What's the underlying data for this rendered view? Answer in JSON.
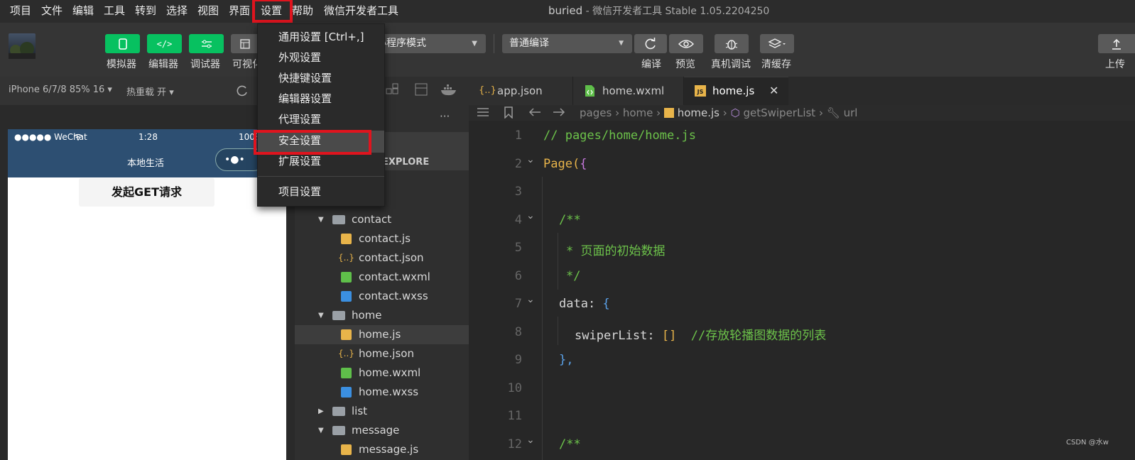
{
  "menubar": {
    "items": [
      "项目",
      "文件",
      "编辑",
      "工具",
      "转到",
      "选择",
      "视图",
      "界面",
      "设置",
      "帮助",
      "微信开发者工具"
    ],
    "title_project": "buried",
    "title_sep": " - ",
    "title_app": "微信开发者工具 Stable 1.05.2204250"
  },
  "toolbar": {
    "buttons": [
      "模拟器",
      "编辑器",
      "调试器",
      "可视化"
    ],
    "mode_select": "小程序模式",
    "compile_select": "普通编译",
    "actions": [
      "编译",
      "预览",
      "真机调试",
      "清缓存"
    ],
    "upload_label": "上传",
    "accent": "#07c160"
  },
  "simulator": {
    "device": "iPhone 6/7/8 85% 16 ▾",
    "hot_reload": "热重载 开 ▾",
    "status_signal": "●●●●● WeChat",
    "status_time": "1:28",
    "status_battery": "100%",
    "nav_title": "本地生活",
    "capsule": "•●•",
    "get_button": "发起GET请求"
  },
  "explorer": {
    "more": "···",
    "section_title": "EXPLORE",
    "tree": [
      {
        "label": "contact",
        "type": "folder",
        "open": true,
        "depth": 1
      },
      {
        "label": "contact.js",
        "type": "js",
        "depth": 2
      },
      {
        "label": "contact.json",
        "type": "json",
        "depth": 2
      },
      {
        "label": "contact.wxml",
        "type": "wxml",
        "depth": 2
      },
      {
        "label": "contact.wxss",
        "type": "wxss",
        "depth": 2
      },
      {
        "label": "home",
        "type": "folder",
        "open": true,
        "depth": 1
      },
      {
        "label": "home.js",
        "type": "js",
        "depth": 2,
        "selected": true
      },
      {
        "label": "home.json",
        "type": "json",
        "depth": 2
      },
      {
        "label": "home.wxml",
        "type": "wxml",
        "depth": 2
      },
      {
        "label": "home.wxss",
        "type": "wxss",
        "depth": 2
      },
      {
        "label": "list",
        "type": "folder",
        "open": false,
        "depth": 1
      },
      {
        "label": "message",
        "type": "folder",
        "open": true,
        "depth": 1
      },
      {
        "label": "message.js",
        "type": "js",
        "depth": 2
      }
    ]
  },
  "editor": {
    "tabs": [
      {
        "label": "app.json",
        "icon": "{..}"
      },
      {
        "label": "home.wxml",
        "icon": "wxml"
      },
      {
        "label": "home.js",
        "icon": "JS",
        "active": true
      }
    ],
    "close": "✕",
    "breadcrumb": [
      "pages",
      "home",
      "home.js",
      "getSwiperList",
      "url"
    ],
    "lines": [
      {
        "n": "1",
        "text": "// pages/home/home.js"
      },
      {
        "n": "2",
        "text": "Page({"
      },
      {
        "n": "3",
        "text": ""
      },
      {
        "n": "4",
        "text": "/**"
      },
      {
        "n": "5",
        "text": "* 页面的初始数据"
      },
      {
        "n": "6",
        "text": "*/"
      },
      {
        "n": "7",
        "text": "data: {"
      },
      {
        "n": "8",
        "text": "swiperList: []  //存放轮播图数据的列表"
      },
      {
        "n": "9",
        "text": "},"
      },
      {
        "n": "10",
        "text": ""
      },
      {
        "n": "11",
        "text": ""
      },
      {
        "n": "12",
        "text": "/**"
      }
    ],
    "colors": {
      "comment": "#6cc24a",
      "keyword": "#e8b44a",
      "brace": "#5aa0e6",
      "text": "#d8d8d8"
    }
  },
  "settings_menu": {
    "items": [
      "通用设置  [Ctrl+,]",
      "外观设置",
      "快捷键设置",
      "编辑器设置",
      "代理设置",
      "安全设置",
      "扩展设置",
      "项目设置"
    ]
  },
  "watermark": "CSDN @水w"
}
